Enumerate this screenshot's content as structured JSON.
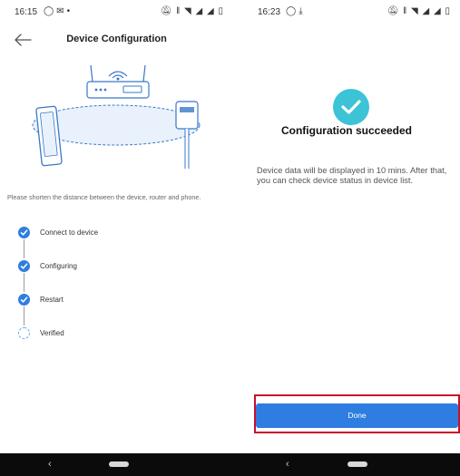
{
  "left_screen": {
    "status_bar": {
      "time": "16:15",
      "left_icons": [
        "whatsapp-icon",
        "mail-icon",
        "dot-icon"
      ],
      "right_icons": [
        "mute-icon",
        "vibrate-icon",
        "wifi-icon",
        "signal-icon",
        "signal-icon",
        "battery-icon"
      ]
    },
    "header": {
      "title": "Device Configuration"
    },
    "hint": "Please shorten the distance between the device, router and phone.",
    "steps": [
      {
        "label": "Connect to device",
        "state": "done"
      },
      {
        "label": "Configuring",
        "state": "done"
      },
      {
        "label": "Restart",
        "state": "done"
      },
      {
        "label": "Verified",
        "state": "loading"
      }
    ],
    "nav_bar": {
      "back_glyph": "‹"
    }
  },
  "right_screen": {
    "status_bar": {
      "time": "16:23",
      "left_icons": [
        "whatsapp-icon",
        "download-icon"
      ],
      "right_icons": [
        "mute-icon",
        "vibrate-icon",
        "wifi-icon",
        "signal-icon",
        "signal-icon",
        "battery-icon"
      ]
    },
    "result": {
      "title": "Configuration succeeded",
      "description": "Device data will be displayed in 10 mins. After that, you can check device status in device list."
    },
    "done_label": "Done",
    "nav_bar": {
      "back_glyph": "‹"
    }
  },
  "colors": {
    "accent": "#2f7de1",
    "success": "#3cc3d6",
    "highlight": "#c8102e",
    "illustration_fill": "#e8f1fc",
    "illustration_line": "#3a78c9"
  }
}
